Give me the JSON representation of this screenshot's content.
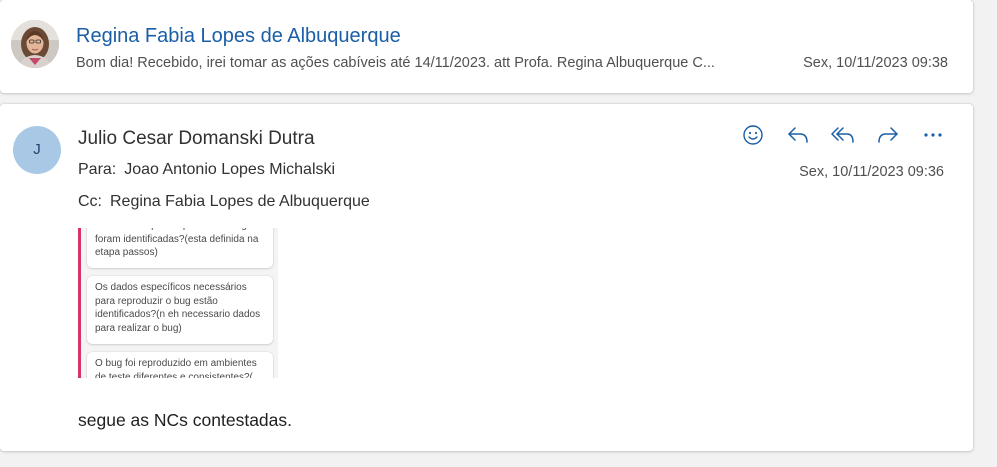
{
  "messages": [
    {
      "sender": "Regina Fabia Lopes de Albuquerque",
      "preview": "Bom dia! Recebido, irei tomar as ações cabíveis até 14/11/2023. att Profa. Regina Albuquerque C...",
      "date": "Sex, 10/11/2023 09:38",
      "avatar": "photo"
    },
    {
      "sender": "Julio Cesar Domanski Dutra",
      "avatar_initial": "J",
      "to_label": "Para:",
      "to": "Joao Antonio Lopes Michalski",
      "cc_label": "Cc:",
      "cc": "Regina Fabia Lopes de Albuquerque",
      "date": "Sex, 10/11/2023 09:36",
      "actions": [
        "emoji-react-icon",
        "reply-icon",
        "reply-all-icon",
        "forward-icon",
        "more-icon"
      ],
      "embedded_image": {
        "cards": [
          "necessarios para reproduzir o bug foram identificadas?(esta definida na etapa passos)",
          "Os dados específicos necessários para reproduzir o bug estão identificados?(n eh necessario dados para realizar o bug)",
          "O bug foi reproduzido em ambientes de teste diferentes e consistentes?("
        ],
        "accent_color": "#d6336c"
      },
      "body": "segue as NCs contestadas."
    }
  ],
  "colors": {
    "sender_link": "#1b5ea6",
    "avatar_bg": "#a9c8e6",
    "icon": "#1b5ea6"
  }
}
